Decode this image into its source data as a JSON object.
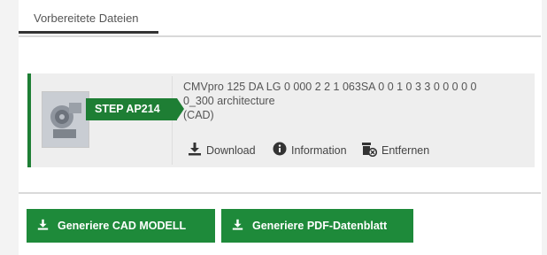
{
  "tabs": {
    "prepared_files": "Vorbereitete Dateien"
  },
  "file": {
    "format_badge": "STEP AP214",
    "title_line1": "CMVpro 125 DA LG 0 000 2 2 1 063SA 0 0 1 0 3 3 0 0 0 0 0",
    "title_line2": "0_300 architecture",
    "title_line3": "(CAD)",
    "actions": {
      "download": "Download",
      "information": "Information",
      "remove": "Entfernen"
    }
  },
  "buttons": {
    "generate_cad": "Generiere CAD MODELL",
    "generate_pdf": "Generiere PDF-Datenblatt"
  },
  "colors": {
    "brand_green": "#1e8a3a",
    "badge_green": "#1e7e34"
  }
}
